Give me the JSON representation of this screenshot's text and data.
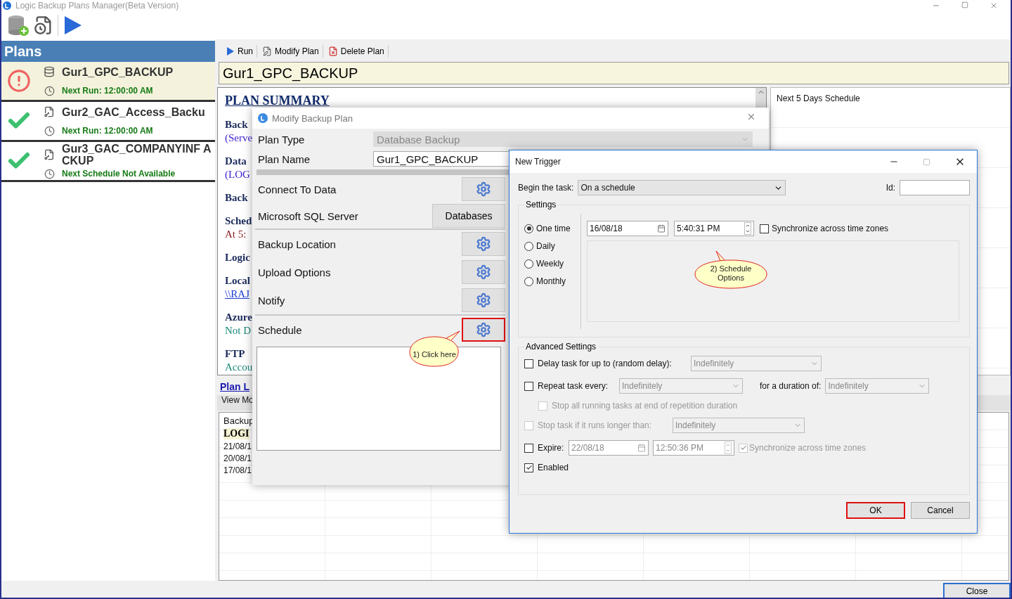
{
  "app": {
    "title": "Logic Backup Plans Manager(Beta Version)"
  },
  "plans": {
    "title": "Plans",
    "items": [
      {
        "name": "Gur1_GPC_BACKUP",
        "failed": true,
        "kind": "database",
        "next": "Next Run: 12:00:00 AM",
        "selected": true
      },
      {
        "name": "Gur2_GAC_Access_Backu",
        "failed": false,
        "kind": "file",
        "next": "Next Run: 12:00:00 AM",
        "selected": false
      },
      {
        "name": "Gur3_GAC_COMPANYINF ACKUP",
        "failed": false,
        "kind": "file",
        "next": "Next Schedule Not Available",
        "selected": false
      }
    ]
  },
  "plan_toolbar": [
    {
      "label": "Run",
      "kind": "run"
    },
    {
      "label": "Modify Plan",
      "kind": "modify"
    },
    {
      "label": "Delete Plan",
      "kind": "delete"
    }
  ],
  "plan_title": "Gur1_GPC_BACKUP",
  "summary": {
    "heading": "PLAN SUMMARY",
    "lines": [
      {
        "text": "Back",
        "kind": "label"
      },
      {
        "text": "(Serve",
        "kind": "value"
      },
      {
        "text": "Data",
        "kind": "label"
      },
      {
        "text": "(LOG",
        "kind": "value"
      },
      {
        "text": "Back",
        "kind": "label"
      },
      {
        "text": "Sched",
        "kind": "label"
      },
      {
        "text": "At 5:",
        "kind": "schedule"
      },
      {
        "text": "Logic",
        "kind": "label"
      },
      {
        "text": "Local",
        "kind": "label"
      },
      {
        "text": "\\\\RAJ",
        "kind": "link"
      },
      {
        "text": "Azure",
        "kind": "label"
      },
      {
        "text": "Not D",
        "kind": "status"
      },
      {
        "text": "FTP",
        "kind": "label"
      },
      {
        "text": "Accou",
        "kind": "status"
      }
    ]
  },
  "plan_log": {
    "link": "Plan L",
    "view": "View Mo",
    "grid_title": "Backup",
    "grid_header": "LOGI",
    "rows": [
      "21/08/1",
      "20/08/1",
      "17/08/1"
    ]
  },
  "next_days": {
    "title": "Next 5 Days Schedule"
  },
  "modify_dialog": {
    "title": "Modify Backup Plan",
    "plan_type": {
      "label": "Plan Type",
      "value": "Database Backup"
    },
    "plan_name": {
      "label": "Plan Name",
      "value": "Gur1_GPC_BACKUP"
    },
    "sections": [
      {
        "label": "Connect To Data",
        "kind": "gear",
        "separated": false,
        "highlighted": false
      },
      {
        "label": "Microsoft SQL Server",
        "kind": "button",
        "button": "Databases",
        "separated": false,
        "highlighted": false
      },
      {
        "label": "Backup Location",
        "kind": "gear",
        "separated": true,
        "highlighted": false
      },
      {
        "label": "Upload Options",
        "kind": "gear",
        "separated": false,
        "highlighted": false
      },
      {
        "label": "Notify",
        "kind": "gear",
        "separated": false,
        "highlighted": false
      },
      {
        "label": "Schedule",
        "kind": "gear",
        "separated": true,
        "highlighted": true
      }
    ]
  },
  "callouts": [
    {
      "text": "1) Click here"
    },
    {
      "text": "2) Schedule Options"
    }
  ],
  "new_trigger": {
    "title": "New Trigger",
    "begin_label": "Begin the task:",
    "begin_value": "On a schedule",
    "id_label": "Id:",
    "settings_title": "Settings",
    "frequencies": [
      {
        "label": "One time",
        "selected": true
      },
      {
        "label": "Daily",
        "selected": false
      },
      {
        "label": "Weekly",
        "selected": false
      },
      {
        "label": "Monthly",
        "selected": false
      }
    ],
    "start_date": "16/08/18",
    "start_time": "5:40:31 PM",
    "sync": {
      "label": "Synchronize across time zones",
      "checked": false
    },
    "advanced_title": "Advanced Settings",
    "delay": {
      "label": "Delay task for up to (random delay):",
      "checked": false,
      "value": "Indefinitely"
    },
    "repeat": {
      "label": "Repeat task every:",
      "checked": false,
      "value": "Indefinitely",
      "duration_label": "for a duration of:",
      "duration_value": "Indefinitely"
    },
    "stop_all": {
      "label": "Stop all running tasks at end of repetition duration",
      "checked": false,
      "disabled": true
    },
    "stop_longer": {
      "label": "Stop task if it runs longer than:",
      "checked": false,
      "disabled": true,
      "value": "Indefinitely"
    },
    "expire": {
      "label": "Expire:",
      "checked": false,
      "date": "22/08/18",
      "time": "12:50:36 PM",
      "sync_label": "Synchronize across time zones",
      "sync_checked": true
    },
    "enabled": {
      "label": "Enabled",
      "checked": true
    },
    "buttons": [
      {
        "label": "OK",
        "highlighted": true
      },
      {
        "label": "Cancel",
        "highlighted": false
      }
    ]
  },
  "close_button": "Close"
}
